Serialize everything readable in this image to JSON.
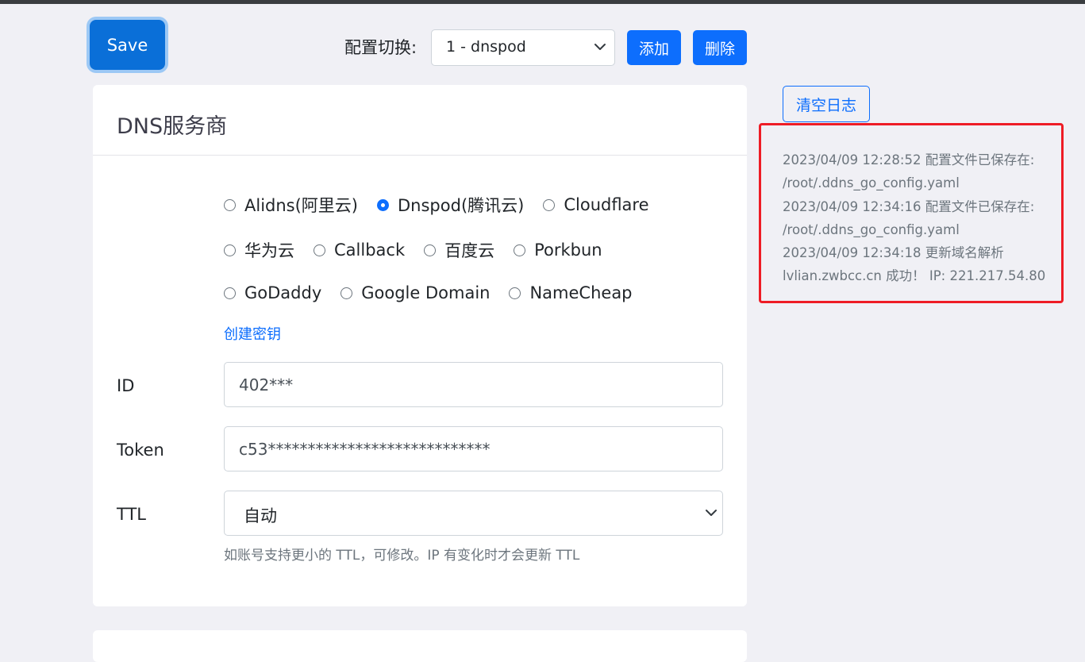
{
  "toolbar": {
    "save_label": "Save",
    "config_label": "配置切换:",
    "config_selected": "1 - dnspod",
    "add_label": "添加",
    "delete_label": "删除"
  },
  "card": {
    "title": "DNS服务商",
    "providers": [
      {
        "label": "Alidns(阿里云)",
        "checked": false
      },
      {
        "label": "Dnspod(腾讯云)",
        "checked": true
      },
      {
        "label": "Cloudflare",
        "checked": false
      },
      {
        "label": "华为云",
        "checked": false
      },
      {
        "label": "Callback",
        "checked": false
      },
      {
        "label": "百度云",
        "checked": false
      },
      {
        "label": "Porkbun",
        "checked": false
      },
      {
        "label": "GoDaddy",
        "checked": false
      },
      {
        "label": "Google Domain",
        "checked": false
      },
      {
        "label": "NameCheap",
        "checked": false
      }
    ],
    "create_key_link": "创建密钥",
    "id_label": "ID",
    "id_value": "402***",
    "token_label": "Token",
    "token_value": "c53****************************",
    "ttl_label": "TTL",
    "ttl_selected": "自动",
    "ttl_hint": "如账号支持更小的 TTL，可修改。IP 有变化时才会更新 TTL"
  },
  "log": {
    "clear_label": "清空日志",
    "lines": [
      "2023/04/09 12:28:52 配置文件已保存在:",
      "/root/.ddns_go_config.yaml",
      "2023/04/09 12:34:16 配置文件已保存在:",
      "/root/.ddns_go_config.yaml",
      "2023/04/09 12:34:18 更新域名解析",
      "lvlian.zwbcc.cn 成功！ IP: 221.217.54.80"
    ],
    "highlight_color": "#ee1c25"
  },
  "colors": {
    "primary": "#0d6efd",
    "background": "#f0f0f5"
  }
}
